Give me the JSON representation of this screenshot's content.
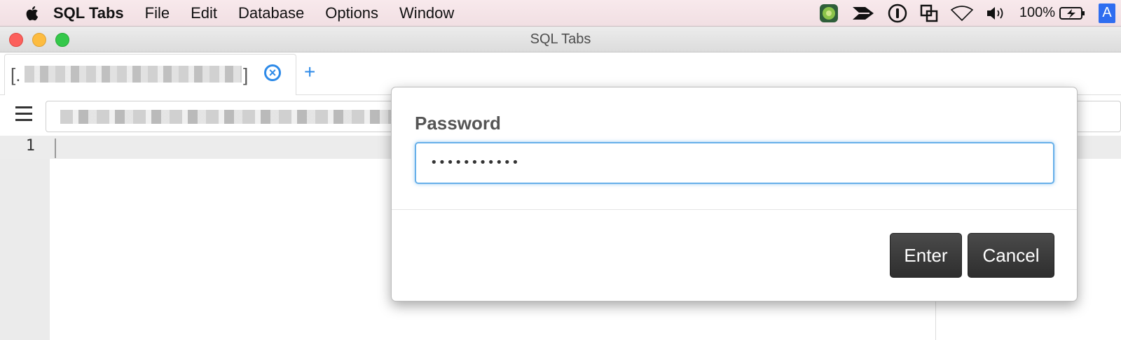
{
  "menubar": {
    "app_name": "SQL Tabs",
    "items": [
      "File",
      "Edit",
      "Database",
      "Options",
      "Window"
    ],
    "battery": "100%",
    "input_source": "A"
  },
  "window": {
    "title": "SQL Tabs"
  },
  "tabs": [
    {
      "open_bracket": "[.",
      "close_bracket": "]"
    }
  ],
  "add_tab_label": "+",
  "editor": {
    "line_numbers": [
      "1"
    ]
  },
  "dialog": {
    "label": "Password",
    "password_value": "•••••••••••",
    "enter_label": "Enter",
    "cancel_label": "Cancel"
  },
  "colors": {
    "accent": "#2d8ae8",
    "focus_ring": "#66afe9",
    "button_dark": "#3a3a3a"
  }
}
